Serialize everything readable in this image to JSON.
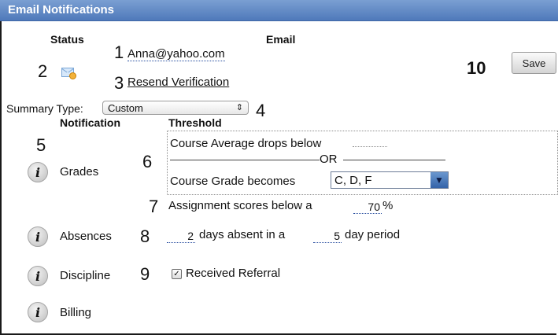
{
  "title": "Email Notifications",
  "columns": {
    "status": "Status",
    "email": "Email",
    "notification": "Notification",
    "threshold": "Threshold"
  },
  "markers": [
    "1",
    "2",
    "3",
    "4",
    "5",
    "6",
    "7",
    "8",
    "9",
    "10"
  ],
  "email": {
    "address": "Anna@yahoo.com",
    "resend": "Resend Verification"
  },
  "save_label": "Save",
  "summary": {
    "label": "Summary Type:",
    "value": "Custom"
  },
  "notifications": [
    {
      "label": "Grades"
    },
    {
      "label": "Absences"
    },
    {
      "label": "Discipline"
    },
    {
      "label": "Billing"
    }
  ],
  "grades": {
    "average_text": "Course Average drops below",
    "or_text": "OR",
    "grade_text": "Course Grade becomes",
    "grade_value": "C, D, F",
    "assignment_text": "Assignment scores below a",
    "assignment_value": "70",
    "percent": "%"
  },
  "absences": {
    "days_value": "2",
    "middle_text": "days absent in a",
    "period_value": "5",
    "end_text": "day period"
  },
  "discipline": {
    "referral_label": "Received Referral",
    "checked": true
  },
  "icons": {
    "status": "envelope-icon",
    "info": "info-icon",
    "select_arrow": "updown-arrow-icon",
    "dropdown_arrow": "triangle-down-icon"
  }
}
